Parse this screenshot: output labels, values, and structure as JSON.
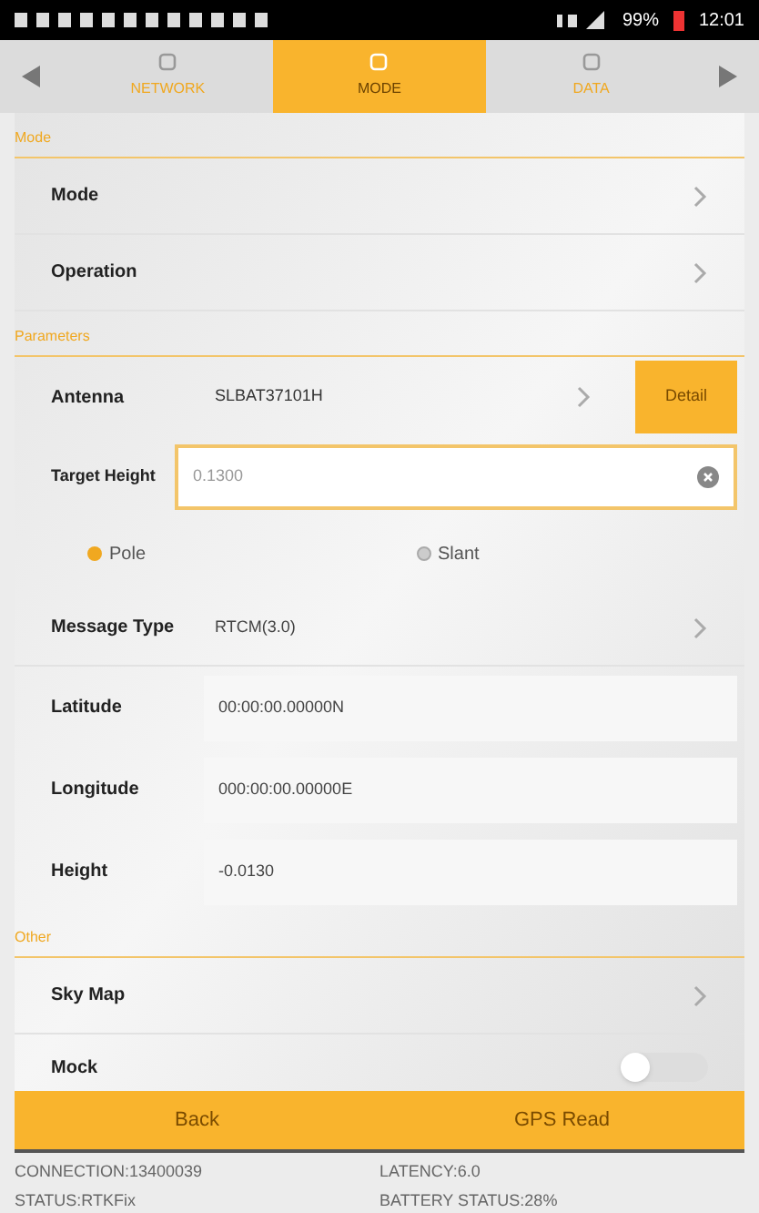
{
  "status_bar": {
    "battery": "99%",
    "time": "12:01"
  },
  "tabs": [
    {
      "label": "NETWORK",
      "selected": false
    },
    {
      "label": "MODE",
      "selected": true
    },
    {
      "label": "DATA",
      "selected": false
    }
  ],
  "sections": [
    {
      "title": "Mode",
      "rows": [
        {
          "kind": "link",
          "label": "Mode"
        },
        {
          "kind": "link",
          "label": "Operation"
        }
      ]
    },
    {
      "title": "Parameters",
      "rows": [
        {
          "kind": "antenna",
          "label": "Antenna",
          "value": "SLBAT37101H",
          "button": "Detail"
        },
        {
          "kind": "input",
          "label": "Target Height",
          "placeholder": "0.1300"
        },
        {
          "kind": "radio",
          "options": [
            {
              "label": "Pole",
              "selected": true
            },
            {
              "label": "Slant",
              "selected": false
            }
          ]
        },
        {
          "kind": "link",
          "label": "Message Type",
          "value": "RTCM(3.0)"
        },
        {
          "kind": "field",
          "label": "Latitude",
          "value": "00:00:00.00000N"
        },
        {
          "kind": "field",
          "label": "Longitude",
          "value": "000:00:00.00000E"
        },
        {
          "kind": "field",
          "label": "Height",
          "value": "-0.0130"
        }
      ]
    },
    {
      "title": "Other",
      "rows": [
        {
          "kind": "link",
          "label": "Sky Map"
        },
        {
          "kind": "toggle",
          "label": "Mock",
          "on": false
        }
      ]
    }
  ],
  "buttons": [
    "Back",
    "GPS Read"
  ],
  "footer": [
    {
      "text": "CONNECTION:13400039"
    },
    {
      "text": "LATENCY:6.0"
    },
    {
      "text": "STATUS:RTKFix"
    },
    {
      "text": "BATTERY STATUS:28%"
    }
  ]
}
